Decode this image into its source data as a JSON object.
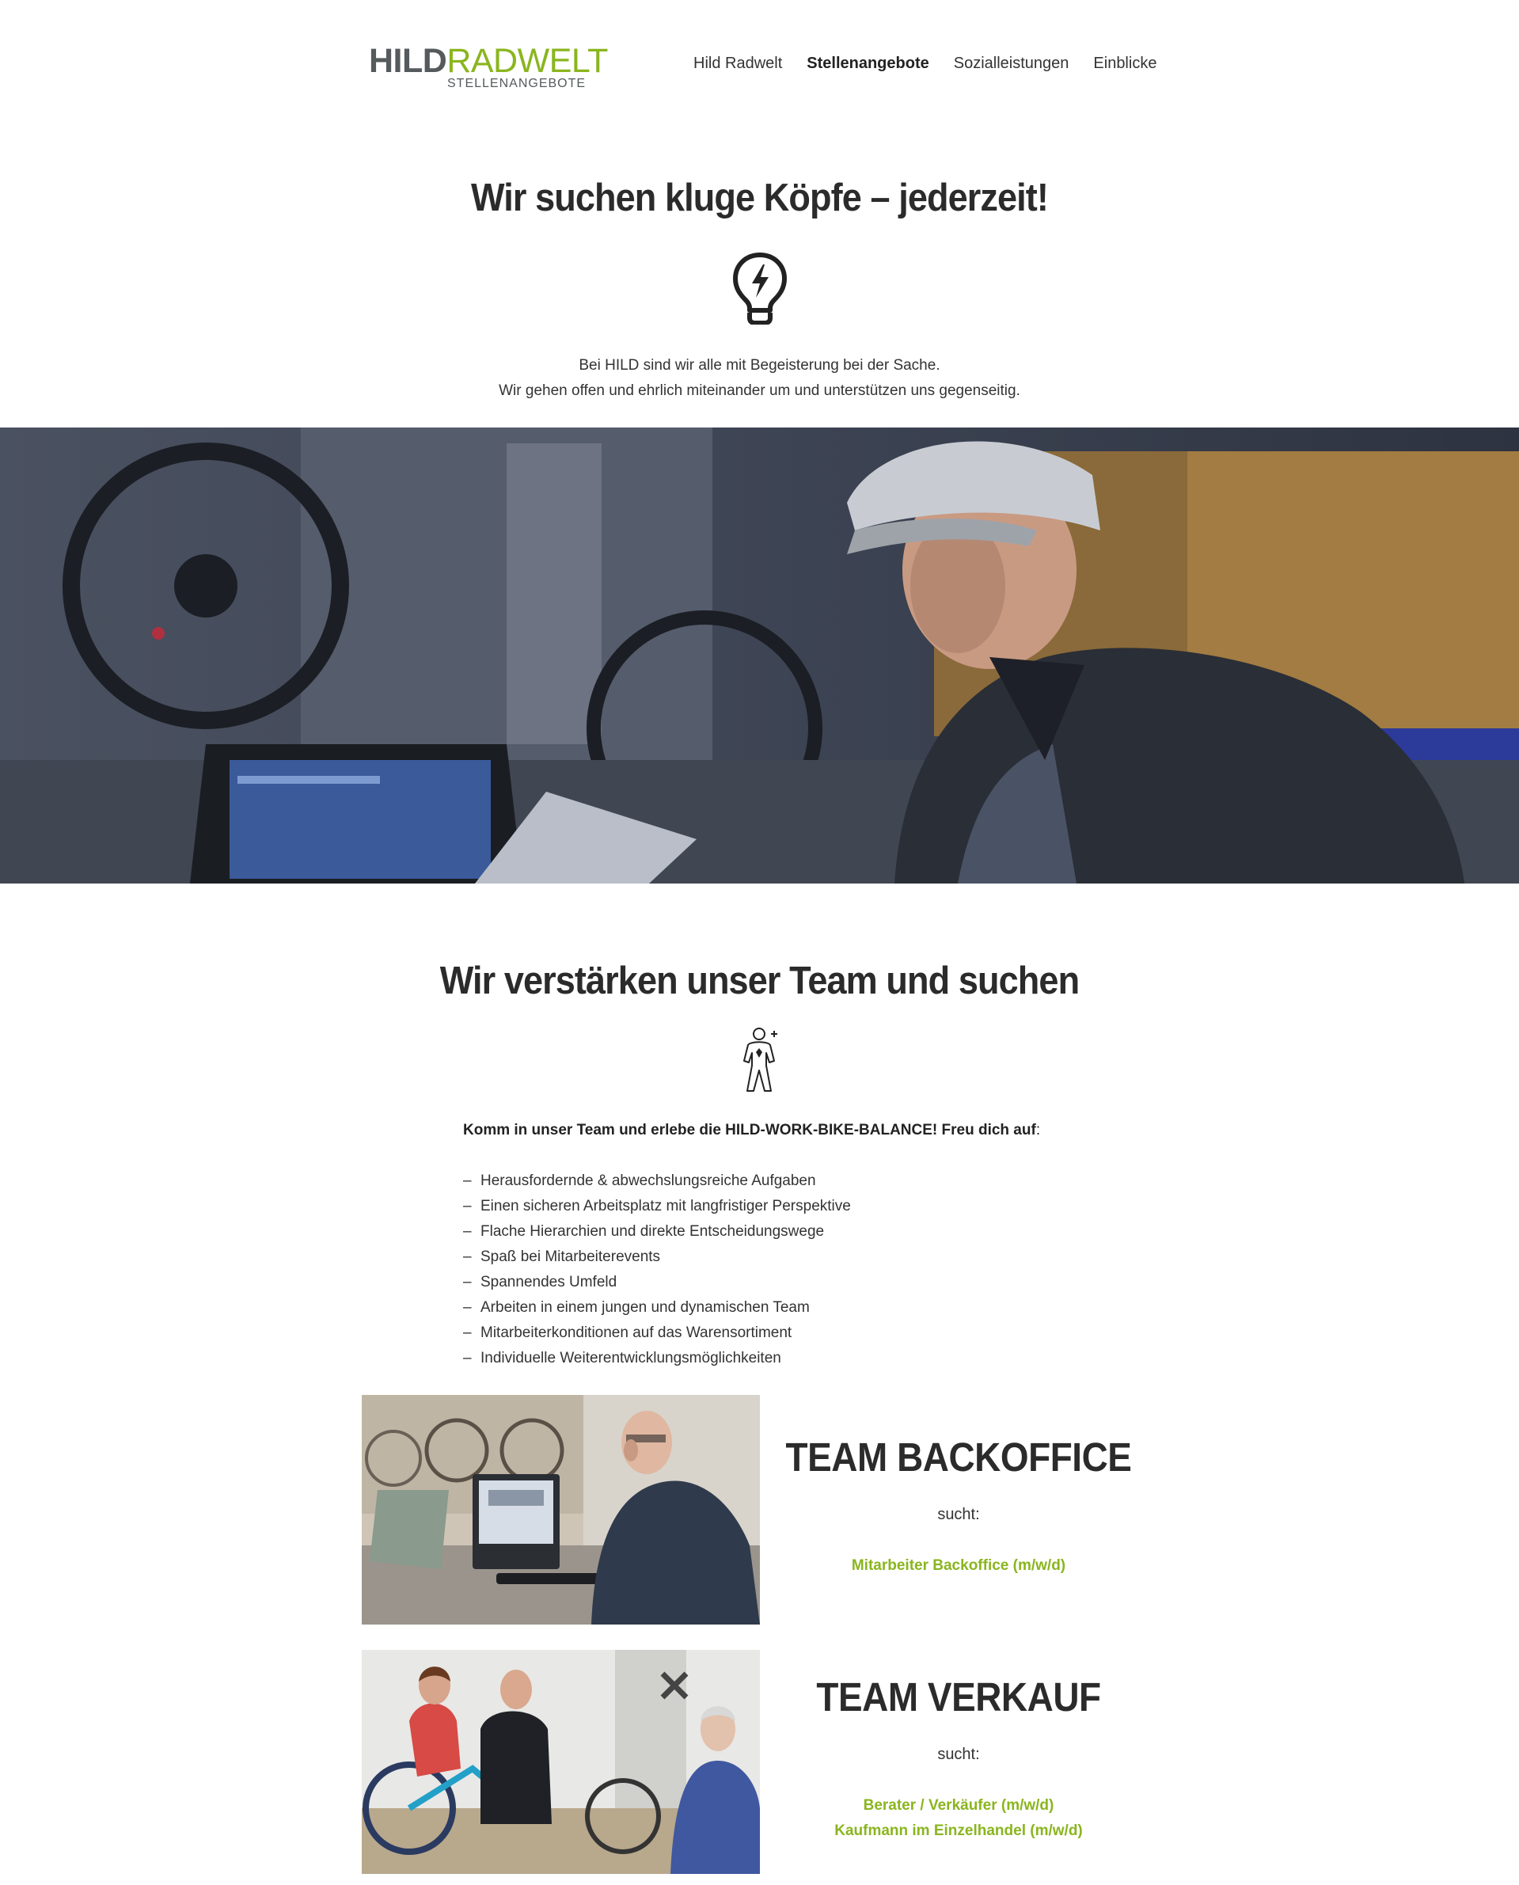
{
  "header": {
    "logo": {
      "word1": "HILD",
      "word2": "RADWELT",
      "tagline": "STELLENANGEBOTE"
    },
    "nav": [
      {
        "label": "Hild Radwelt",
        "active": false
      },
      {
        "label": "Stellenangebote",
        "active": true
      },
      {
        "label": "Sozialleistungen",
        "active": false
      },
      {
        "label": "Einblicke",
        "active": false
      }
    ]
  },
  "section1": {
    "title": "Wir suchen kluge Köpfe – jederzeit!",
    "icon": "lightbulb-icon",
    "lines": [
      "Bei HILD sind wir alle mit Begeisterung bei der Sache.",
      "Wir gehen offen und ehrlich miteinander um und unterstützen uns gegenseitig."
    ]
  },
  "section2": {
    "title": "Wir verstärken unser Team und suchen",
    "icon": "person-icon",
    "intro_bold": "Komm in unser Team und erlebe die HILD-WORK-BIKE-BALANCE! Freu dich auf",
    "intro_rest": ":",
    "perks": [
      "Herausfordernde & abwechslungsreiche Aufgaben",
      "Einen sicheren Arbeitsplatz mit langfristiger Perspektive",
      "Flache Hierarchien und direkte Entscheidungswege",
      "Spaß bei Mitarbeiterevents",
      "Spannendes Umfeld",
      "Arbeiten in einem jungen und dynamischen Team",
      "Mitarbeiterkonditionen auf das Warensortiment",
      "Individuelle Weiterentwicklungsmöglichkeiten"
    ]
  },
  "teams": [
    {
      "title": "TEAM BACKOFFICE",
      "sucht": "sucht:",
      "jobs": [
        "Mitarbeiter Backoffice (m/w/d)"
      ]
    },
    {
      "title": "TEAM VERKAUF",
      "sucht": "sucht:",
      "jobs": [
        "Berater / Verkäufer (m/w/d)",
        "Kaufmann im Einzelhandel (m/w/d)"
      ]
    }
  ],
  "colors": {
    "accent": "#8ab51e",
    "text": "#333333",
    "logo_gray": "#555a5c"
  }
}
